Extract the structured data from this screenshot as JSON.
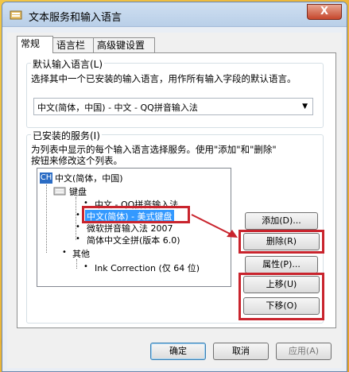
{
  "window": {
    "title": "文本服务和输入语言",
    "close": "X"
  },
  "tabs": [
    {
      "label": "常规"
    },
    {
      "label": "语言栏"
    },
    {
      "label": "高级键设置"
    }
  ],
  "default_lang": {
    "legend": "默认输入语言(L)",
    "desc": "选择其中一个已安装的输入语言，用作所有输入字段的默认语言。",
    "selected": "中文(简体，中国) - 中文 - QQ拼音输入法"
  },
  "installed": {
    "legend": "已安装的服务(I)",
    "desc_line1": "为列表中显示的每个输入语言选择服务。使用\"添加\"和\"删除\"",
    "desc_line2": "按钮来修改这个列表。",
    "language": "中文(简体，中国)",
    "language_icon": "CH",
    "keyboard_label": "键盘",
    "keyboards": [
      "中文 - QQ拼音输入法",
      "中文(简体) - 美式键盘",
      "微软拼音输入法 2007",
      "简体中文全拼(版本 6.0)"
    ],
    "other_label": "其他",
    "other_items": [
      "Ink Correction (仅 64 位)"
    ]
  },
  "buttons": {
    "add": "添加(D)...",
    "remove": "删除(R)",
    "properties": "属性(P)...",
    "move_up": "上移(U)",
    "move_down": "下移(O)"
  },
  "footer": {
    "ok": "确定",
    "cancel": "取消",
    "apply": "应用(A)"
  },
  "colors": {
    "highlight_box": "#c9242d",
    "selection": "#3399ff"
  }
}
